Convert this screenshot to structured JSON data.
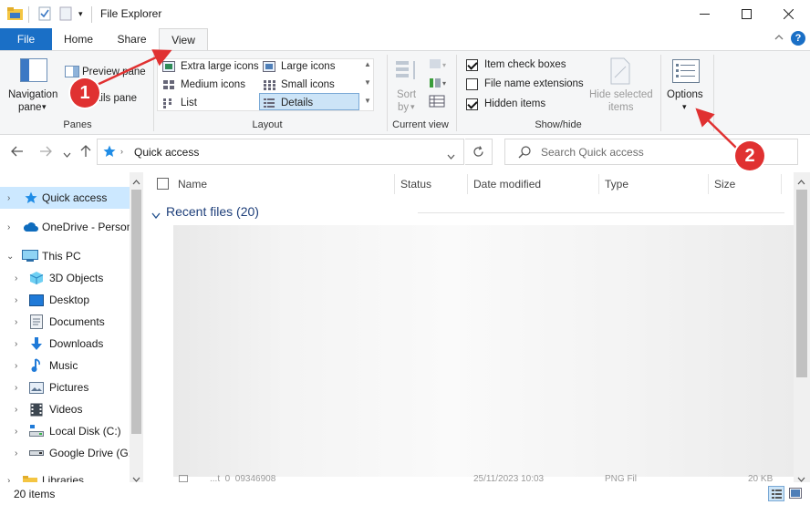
{
  "window": {
    "title": "File Explorer",
    "controls": [
      "minimize-icon",
      "maximize-icon",
      "close-icon"
    ]
  },
  "tabs": [
    {
      "label": "File"
    },
    {
      "label": "Home"
    },
    {
      "label": "Share"
    },
    {
      "label": "View",
      "active": true
    }
  ],
  "ribbon": {
    "panes": {
      "label": "Panes",
      "navigation_pane": "Navigation",
      "navigation_pane_2": "pane",
      "preview_pane": "Preview pane",
      "details_pane": "ails pane"
    },
    "layout": {
      "label": "Layout",
      "options": [
        "Extra large icons",
        "Large icons",
        "Medium icons",
        "Small icons",
        "List",
        "Details"
      ],
      "selected": "Details"
    },
    "current_view": {
      "label": "Current view",
      "sort_by": "Sort",
      "sort_by_2": "by"
    },
    "show_hide": {
      "label": "Show/hide",
      "item_check_boxes": {
        "label": "Item check boxes",
        "checked": true
      },
      "file_name_extensions": {
        "label": "File name extensions",
        "checked": false
      },
      "hidden_items": {
        "label": "Hidden items",
        "checked": true
      },
      "hide_selected": "Hide selected",
      "hide_selected_2": "items"
    },
    "options": {
      "label": "Options"
    }
  },
  "address": {
    "path": "Quick access",
    "search_placeholder": "Search Quick access"
  },
  "sidebar": {
    "items": [
      {
        "label": "Quick access",
        "icon": "star-icon",
        "selected": true
      },
      {
        "label": "OneDrive - Person",
        "icon": "cloud-icon"
      },
      {
        "label": "This PC",
        "icon": "computer-icon",
        "expanded": true
      },
      {
        "label": "3D Objects",
        "icon": "cube-icon"
      },
      {
        "label": "Desktop",
        "icon": "desktop-icon"
      },
      {
        "label": "Documents",
        "icon": "document-icon"
      },
      {
        "label": "Downloads",
        "icon": "download-icon"
      },
      {
        "label": "Music",
        "icon": "music-icon"
      },
      {
        "label": "Pictures",
        "icon": "picture-icon"
      },
      {
        "label": "Videos",
        "icon": "video-icon"
      },
      {
        "label": "Local Disk (C:)",
        "icon": "disk-icon"
      },
      {
        "label": "Google Drive (G:",
        "icon": "drive-icon"
      },
      {
        "label": "Libraries",
        "icon": "folder-icon"
      }
    ]
  },
  "content": {
    "columns": [
      "Name",
      "Status",
      "Date modified",
      "Type",
      "Size"
    ],
    "group_header": "Recent files (20)",
    "peek_row": {
      "name": "...t_0_09346908",
      "date": "25/11/2023 10:03",
      "type": "PNG Fil",
      "size": "20 KB"
    }
  },
  "status": {
    "item_count": "20 items"
  },
  "annotations": [
    {
      "number": "1",
      "color": "#e03131"
    },
    {
      "number": "2",
      "color": "#e03131"
    }
  ],
  "colors": {
    "file_tab": "#1a6fc6",
    "selection": "#cce8ff",
    "annotation": "#e03131"
  }
}
